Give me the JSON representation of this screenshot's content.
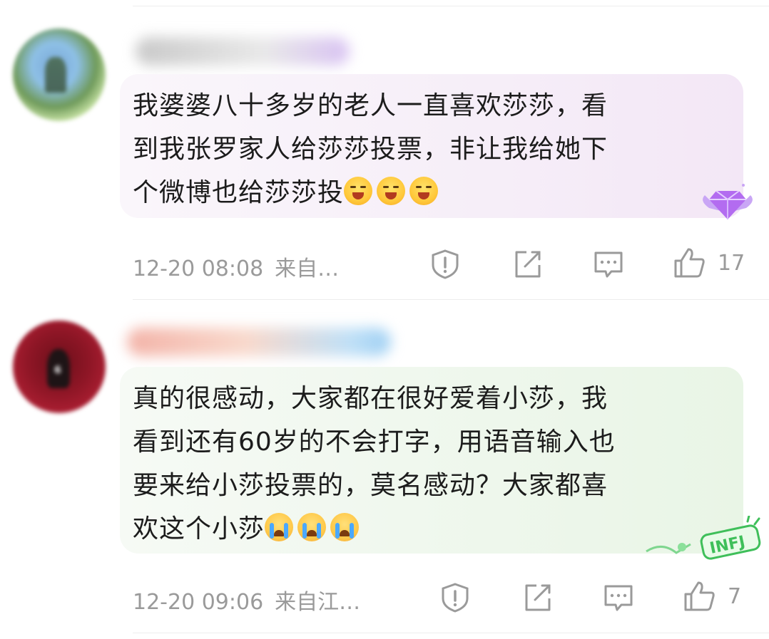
{
  "comments": [
    {
      "text_lines": [
        "我婆婆八十多岁的老人一直喜欢莎莎，看",
        "到我张罗家人给莎莎投票，非让我给她下",
        "个微博也给莎莎投"
      ],
      "emoji": [
        "laugh-cry-emoji",
        "laugh-cry-emoji",
        "laugh-cry-emoji"
      ],
      "time": "12-20 08:08",
      "source": "来自…",
      "likes": "17",
      "colors": {
        "bubble": "#f6eef8",
        "badge": "#b36cf0"
      }
    },
    {
      "text_lines": [
        "真的很感动，大家都在很好爱着小莎，我",
        "看到还有60岁的不会打字，用语音输入也",
        "要来给小莎投票的，莫名感动？大家都喜",
        "欢这个小莎"
      ],
      "emoji": [
        "crying-emoji",
        "crying-emoji",
        "crying-emoji"
      ],
      "time": "12-20 09:06",
      "source": "来自江…",
      "likes": "7",
      "badge_text": "INFJ",
      "colors": {
        "bubble": "#eef7ec",
        "badge": "#3fbf5a"
      }
    }
  ]
}
